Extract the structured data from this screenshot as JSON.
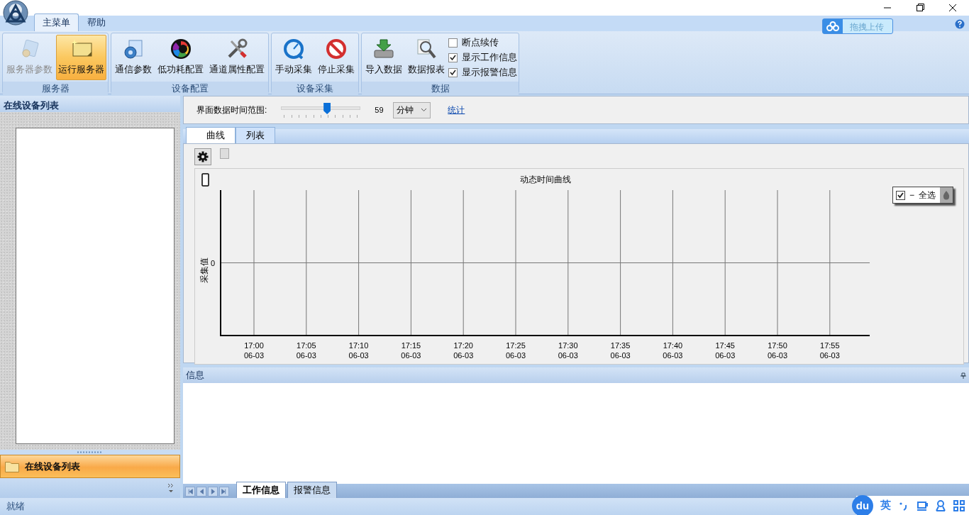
{
  "ribbon_tabs": [
    {
      "label": "主菜单",
      "selected": true
    },
    {
      "label": "帮助",
      "selected": false
    }
  ],
  "upload_button": {
    "label": "拖拽上传"
  },
  "ribbon_groups": [
    {
      "title": "服务器",
      "items": [
        {
          "kind": "button",
          "label": "服务器参数",
          "disabled": true,
          "selected": false
        },
        {
          "kind": "button",
          "label": "运行服务器",
          "disabled": false,
          "selected": true
        }
      ]
    },
    {
      "title": "设备配置",
      "items": [
        {
          "kind": "button",
          "label": "通信参数",
          "disabled": false,
          "selected": false
        },
        {
          "kind": "button",
          "label": "低功耗配置",
          "disabled": false,
          "selected": false
        },
        {
          "kind": "button",
          "label": "通道属性配置",
          "disabled": false,
          "selected": false
        }
      ]
    },
    {
      "title": "设备采集",
      "items": [
        {
          "kind": "button",
          "label": "手动采集",
          "disabled": false,
          "selected": false
        },
        {
          "kind": "button",
          "label": "停止采集",
          "disabled": false,
          "selected": false
        }
      ]
    },
    {
      "title": "数据",
      "items": [
        {
          "kind": "button",
          "label": "导入数据",
          "disabled": false,
          "selected": false
        },
        {
          "kind": "button",
          "label": "数据报表",
          "disabled": false,
          "selected": false
        },
        {
          "kind": "checkbox",
          "label": "断点续传",
          "checked": false
        },
        {
          "kind": "checkbox",
          "label": "显示工作信息",
          "checked": true
        },
        {
          "kind": "checkbox",
          "label": "显示报警信息",
          "checked": true
        }
      ]
    }
  ],
  "sidebar": {
    "title": "在线设备列表",
    "nav_items": [
      {
        "label": "在线设备列表",
        "selected": true
      }
    ]
  },
  "toolbar": {
    "range_label": "界面数据时间范围:",
    "slider": {
      "level": 0.58
    },
    "range_value": "59",
    "unit": "分钟",
    "link": "统计"
  },
  "view_tabs": [
    {
      "label": "曲线",
      "selected": true
    },
    {
      "label": "列表",
      "selected": false
    }
  ],
  "chart": {
    "legend": {
      "checked": true,
      "dash": "−",
      "label": "全选"
    },
    "title": "动态时间曲线",
    "y_axis_label": "采集值",
    "y_tick": "0",
    "x_ticks": [
      {
        "time": "17:00",
        "date": "06-03"
      },
      {
        "time": "17:05",
        "date": "06-03"
      },
      {
        "time": "17:10",
        "date": "06-03"
      },
      {
        "time": "17:15",
        "date": "06-03"
      },
      {
        "time": "17:20",
        "date": "06-03"
      },
      {
        "time": "17:25",
        "date": "06-03"
      },
      {
        "time": "17:30",
        "date": "06-03"
      },
      {
        "time": "17:35",
        "date": "06-03"
      },
      {
        "time": "17:40",
        "date": "06-03"
      },
      {
        "time": "17:45",
        "date": "06-03"
      },
      {
        "time": "17:50",
        "date": "06-03"
      },
      {
        "time": "17:55",
        "date": "06-03"
      }
    ]
  },
  "info_panel": {
    "title": "信息",
    "tabs": [
      {
        "label": "工作信息",
        "selected": true
      },
      {
        "label": "报警信息",
        "selected": false
      }
    ]
  },
  "status_bar": {
    "text": "就绪"
  },
  "ime_bar": {
    "logo": "du",
    "mode": "英"
  }
}
